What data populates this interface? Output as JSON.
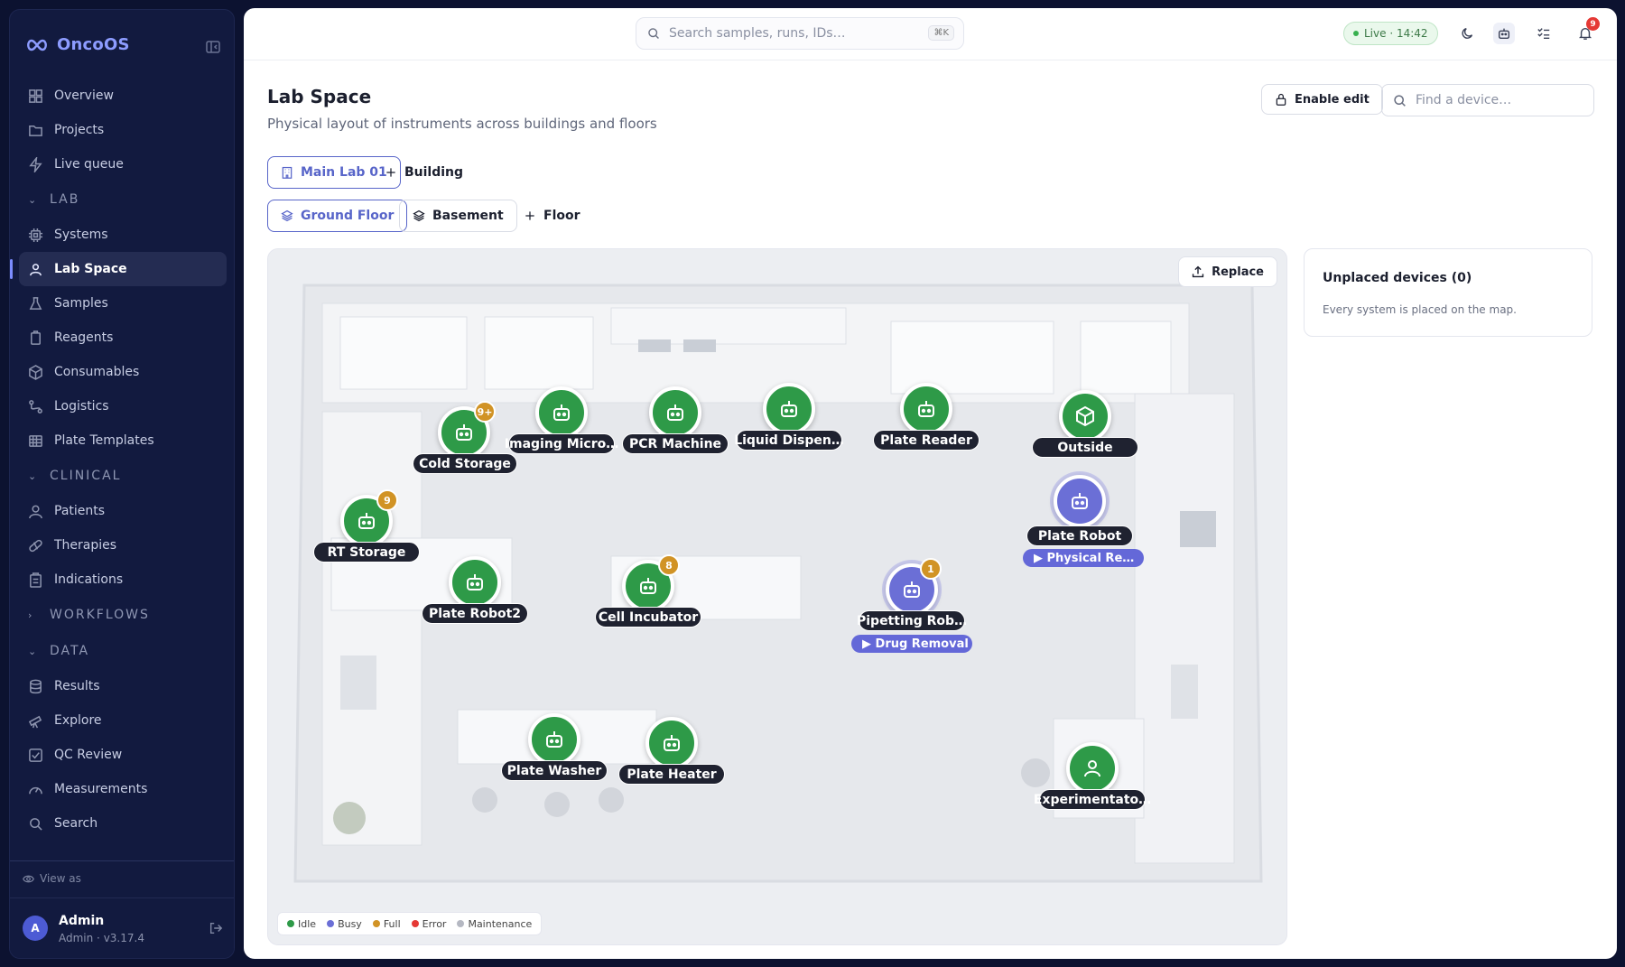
{
  "app": {
    "name": "OncoOS",
    "brand_color": "#8d9cff"
  },
  "sidebar": {
    "items_top": [
      {
        "label": "Overview",
        "icon": "grid-icon"
      },
      {
        "label": "Projects",
        "icon": "folder-icon"
      },
      {
        "label": "Live queue",
        "icon": "bolt-icon"
      }
    ],
    "sections": {
      "lab": "LAB",
      "clinical": "CLINICAL",
      "workflows": "WORKFLOWS",
      "data": "DATA"
    },
    "lab_items": [
      {
        "label": "Systems",
        "icon": "chip-icon"
      },
      {
        "label": "Lab Space",
        "icon": "map-pin-icon",
        "active": true
      },
      {
        "label": "Samples",
        "icon": "flask-icon"
      },
      {
        "label": "Reagents",
        "icon": "bottle-icon"
      },
      {
        "label": "Consumables",
        "icon": "box-icon"
      },
      {
        "label": "Logistics",
        "icon": "route-icon"
      },
      {
        "label": "Plate Templates",
        "icon": "plate-icon"
      }
    ],
    "clinical_items": [
      {
        "label": "Patients",
        "icon": "user-icon"
      },
      {
        "label": "Therapies",
        "icon": "pill-icon"
      },
      {
        "label": "Indications",
        "icon": "clipboard-icon"
      }
    ],
    "data_items": [
      {
        "label": "Results",
        "icon": "database-icon"
      },
      {
        "label": "Explore",
        "icon": "telescope-icon"
      },
      {
        "label": "QC Review",
        "icon": "check-square-icon"
      },
      {
        "label": "Measurements",
        "icon": "gauge-icon"
      },
      {
        "label": "Search",
        "icon": "search-icon"
      }
    ],
    "view_as": "View as",
    "user": {
      "initial": "A",
      "name": "Admin",
      "sub": "Admin · v3.17.4"
    }
  },
  "topbar": {
    "search_placeholder": "Search samples, runs, IDs…",
    "shortcut": "⌘K",
    "live_label": "Live · 14:42",
    "notifications": "9"
  },
  "page": {
    "title": "Lab Space",
    "subtitle": "Physical layout of instruments across buildings and floors",
    "enable_edit": "Enable edit",
    "find_placeholder": "Find a device…",
    "buildings": [
      {
        "label": "Main Lab 01",
        "selected": true
      }
    ],
    "add_building": "Building",
    "floors": [
      {
        "label": "Ground Floor",
        "selected": true
      },
      {
        "label": "Basement",
        "selected": false
      }
    ],
    "add_floor": "Floor"
  },
  "map": {
    "replace_label": "Replace",
    "devices": [
      {
        "name": "Cold Storage",
        "status": "idle",
        "icon": "robot-icon",
        "badge": "9+"
      },
      {
        "name": "Imaging Micro…",
        "status": "idle",
        "icon": "robot-icon"
      },
      {
        "name": "PCR Machine",
        "status": "idle",
        "icon": "robot-icon"
      },
      {
        "name": "Liquid Dispen…",
        "status": "idle",
        "icon": "robot-icon"
      },
      {
        "name": "Plate Reader",
        "status": "idle",
        "icon": "robot-icon"
      },
      {
        "name": "Outside",
        "status": "idle",
        "icon": "cube-icon"
      },
      {
        "name": "RT Storage",
        "status": "idle",
        "icon": "robot-icon",
        "badge": "9"
      },
      {
        "name": "Plate Robot",
        "status": "busy",
        "icon": "robot-icon",
        "run": "▶ Physical Re…"
      },
      {
        "name": "Plate Robot2",
        "status": "idle",
        "icon": "robot-icon"
      },
      {
        "name": "Cell Incubator",
        "status": "idle",
        "icon": "robot-icon",
        "badge": "8"
      },
      {
        "name": "Pipetting Rob…",
        "status": "busy",
        "icon": "robot-icon",
        "badge": "1",
        "run": "▶ Drug Removal"
      },
      {
        "name": "Plate Washer",
        "status": "idle",
        "icon": "robot-icon"
      },
      {
        "name": "Plate Heater",
        "status": "idle",
        "icon": "robot-icon"
      },
      {
        "name": "Experimentato…",
        "status": "idle",
        "icon": "person-icon"
      }
    ],
    "legend": [
      {
        "label": "Idle",
        "color": "#2e9a48"
      },
      {
        "label": "Busy",
        "color": "#6b6fd6"
      },
      {
        "label": "Full",
        "color": "#d19325"
      },
      {
        "label": "Error",
        "color": "#e53935"
      },
      {
        "label": "Maintenance",
        "color": "#b5b8c2"
      }
    ]
  },
  "unplaced": {
    "title": "Unplaced devices (0)",
    "subtitle": "Every system is placed on the map."
  }
}
